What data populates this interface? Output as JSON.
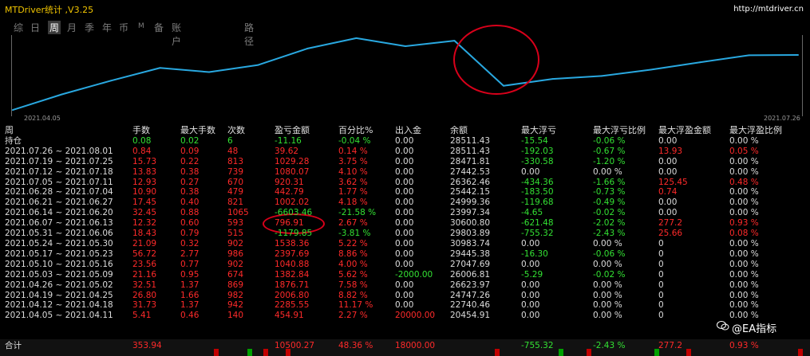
{
  "window": {
    "title": "MTDriver统计 ,V3.25",
    "url": "http://mtdriver.cn"
  },
  "tabs": [
    "综",
    "日",
    "周",
    "月",
    "季",
    "年",
    "币",
    "M",
    "备",
    "账户",
    "路径"
  ],
  "active_tab": "周",
  "chart_data": {
    "type": "line",
    "x_start": "2021.04.05",
    "x_end": "2021.07.26",
    "x": [
      "2021.04.05",
      "2021.04.12",
      "2021.04.19",
      "2021.04.26",
      "2021.05.03",
      "2021.05.10",
      "2021.05.17",
      "2021.05.24",
      "2021.05.31",
      "2021.06.07",
      "2021.06.14",
      "2021.06.21",
      "2021.06.28",
      "2021.07.05",
      "2021.07.12",
      "2021.07.19",
      "2021.07.26"
    ],
    "values": [
      20454.91,
      22740.46,
      24747.26,
      26623.97,
      26006.81,
      27047.69,
      29445.38,
      30983.74,
      29803.89,
      30600.8,
      23997.34,
      24999.36,
      25442.15,
      26362.46,
      27442.53,
      28471.81,
      28511.43
    ],
    "line_color": "#29a8e0"
  },
  "table": {
    "headers": [
      "周",
      "手数",
      "最大手数",
      "次数",
      "盈亏金额",
      "百分比%",
      "出入金",
      "余额",
      "最大浮亏",
      "最大浮亏比例",
      "最大浮盈金额",
      "最大浮盈比例"
    ],
    "hold_row": [
      "持仓",
      "0.08",
      "0.02",
      "6",
      "-11.16",
      "-0.04 %",
      "0.00",
      "28511.43",
      "-15.54",
      "-0.06 %",
      "0.00",
      "0.00 %"
    ],
    "rows": [
      [
        "2021.07.26 ~ 2021.08.01",
        "0.84",
        "0.09",
        "48",
        "39.62",
        "0.14 %",
        "0.00",
        "28511.43",
        "-192.03",
        "-0.67 %",
        "13.93",
        "0.05 %"
      ],
      [
        "2021.07.19 ~ 2021.07.25",
        "15.73",
        "0.22",
        "813",
        "1029.28",
        "3.75 %",
        "0.00",
        "28471.81",
        "-330.58",
        "-1.20 %",
        "0.00",
        "0.00 %"
      ],
      [
        "2021.07.12 ~ 2021.07.18",
        "13.83",
        "0.38",
        "739",
        "1080.07",
        "4.10 %",
        "0.00",
        "27442.53",
        "0.00",
        "0.00 %",
        "0.00",
        "0.00 %"
      ],
      [
        "2021.07.05 ~ 2021.07.11",
        "12.93",
        "0.27",
        "670",
        "920.31",
        "3.62 %",
        "0.00",
        "26362.46",
        "-434.36",
        "-1.66 %",
        "125.45",
        "0.48 %"
      ],
      [
        "2021.06.28 ~ 2021.07.04",
        "10.90",
        "0.38",
        "479",
        "442.79",
        "1.77 %",
        "0.00",
        "25442.15",
        "-183.50",
        "-0.73 %",
        "0.74",
        "0.00 %"
      ],
      [
        "2021.06.21 ~ 2021.06.27",
        "17.45",
        "0.40",
        "821",
        "1002.02",
        "4.18 %",
        "0.00",
        "24999.36",
        "-119.68",
        "-0.49 %",
        "0.00",
        "0.00 %"
      ],
      [
        "2021.06.14 ~ 2021.06.20",
        "32.45",
        "0.88",
        "1065",
        "-6603.46",
        "-21.58 %",
        "0.00",
        "23997.34",
        "-4.65",
        "-0.02 %",
        "0.00",
        "0.00 %"
      ],
      [
        "2021.06.07 ~ 2021.06.13",
        "12.32",
        "0.60",
        "593",
        "796.91",
        "2.67 %",
        "0.00",
        "30600.80",
        "-621.48",
        "-2.02 %",
        "277.2",
        "0.93 %"
      ],
      [
        "2021.05.31 ~ 2021.06.06",
        "18.43",
        "0.79",
        "515",
        "-1179.85",
        "-3.81 %",
        "0.00",
        "29803.89",
        "-755.32",
        "-2.43 %",
        "25.66",
        "0.08 %"
      ],
      [
        "2021.05.24 ~ 2021.05.30",
        "21.09",
        "0.32",
        "902",
        "1538.36",
        "5.22 %",
        "0.00",
        "30983.74",
        "0.00",
        "0.00 %",
        "0",
        "0.00 %"
      ],
      [
        "2021.05.17 ~ 2021.05.23",
        "56.72",
        "2.77",
        "986",
        "2397.69",
        "8.86 %",
        "0.00",
        "29445.38",
        "-16.30",
        "-0.06 %",
        "0",
        "0.00 %"
      ],
      [
        "2021.05.10 ~ 2021.05.16",
        "23.56",
        "0.77",
        "902",
        "1040.88",
        "4.00 %",
        "0.00",
        "27047.69",
        "0.00",
        "0.00 %",
        "0",
        "0.00 %"
      ],
      [
        "2021.05.03 ~ 2021.05.09",
        "21.16",
        "0.95",
        "674",
        "1382.84",
        "5.62 %",
        "-2000.00",
        "26006.81",
        "-5.29",
        "-0.02 %",
        "0",
        "0.00 %"
      ],
      [
        "2021.04.26 ~ 2021.05.02",
        "32.51",
        "1.37",
        "869",
        "1876.71",
        "7.58 %",
        "0.00",
        "26623.97",
        "0.00",
        "0.00 %",
        "0",
        "0.00 %"
      ],
      [
        "2021.04.19 ~ 2021.04.25",
        "26.80",
        "1.66",
        "982",
        "2006.80",
        "8.82 %",
        "0.00",
        "24747.26",
        "0.00",
        "0.00 %",
        "0",
        "0.00 %"
      ],
      [
        "2021.04.12 ~ 2021.04.18",
        "31.73",
        "1.37",
        "942",
        "2285.55",
        "11.17 %",
        "0.00",
        "22740.46",
        "0.00",
        "0.00 %",
        "0",
        "0.00 %"
      ],
      [
        "2021.04.05 ~ 2021.04.11",
        "5.41",
        "0.46",
        "140",
        "454.91",
        "2.27 %",
        "20000.00",
        "20454.91",
        "0.00",
        "0.00 %",
        "0",
        "0.00 %"
      ]
    ],
    "total_row": [
      "合计",
      "353.94",
      "",
      "",
      "10500.27",
      "48.36 %",
      "18000.00",
      "",
      "-755.32",
      "-2.43 %",
      "277.2",
      "0.93 %"
    ]
  },
  "watermark": "@EA指标",
  "colors": {
    "background": "#000000",
    "title": "#f0c400",
    "positive": "#ff2a2a",
    "negative": "#33e133",
    "annotation": "#d8001a"
  }
}
